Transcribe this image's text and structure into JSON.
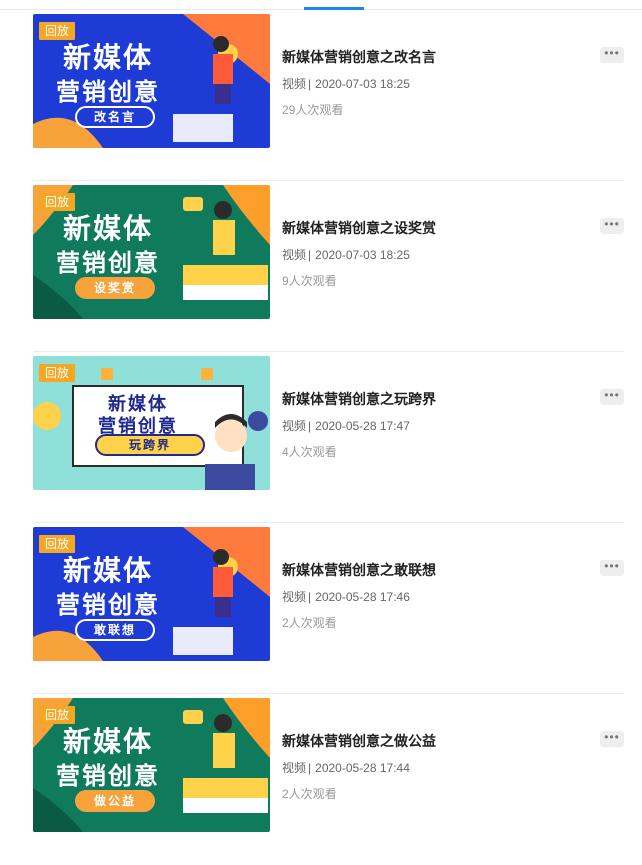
{
  "badge_label": "回放",
  "more_label": "•••",
  "items": [
    {
      "title": "新媒体营销创意之改名言",
      "type": "视频",
      "separator": "|",
      "date": "2020-07-03 18:25",
      "views": "29人次观看",
      "thumb": {
        "line1": "新媒体",
        "line2": "营销创意",
        "tag": "改名言",
        "theme": "blue"
      }
    },
    {
      "title": "新媒体营销创意之设奖赏",
      "type": "视频",
      "separator": "|",
      "date": "2020-07-03 18:25",
      "views": "9人次观看",
      "thumb": {
        "line1": "新媒体",
        "line2": "营销创意",
        "tag": "设奖赏",
        "theme": "green"
      }
    },
    {
      "title": "新媒体营销创意之玩跨界",
      "type": "视频",
      "separator": "|",
      "date": "2020-05-28 17:47",
      "views": "4人次观看",
      "thumb": {
        "line1": "新媒体",
        "line2": "营销创意",
        "tag": "玩跨界",
        "theme": "teal"
      }
    },
    {
      "title": "新媒体营销创意之敢联想",
      "type": "视频",
      "separator": "|",
      "date": "2020-05-28 17:46",
      "views": "2人次观看",
      "thumb": {
        "line1": "新媒体",
        "line2": "营销创意",
        "tag": "敢联想",
        "theme": "blue"
      }
    },
    {
      "title": "新媒体营销创意之做公益",
      "type": "视频",
      "separator": "|",
      "date": "2020-05-28 17:44",
      "views": "2人次观看",
      "thumb": {
        "line1": "新媒体",
        "line2": "营销创意",
        "tag": "做公益",
        "theme": "green"
      }
    }
  ],
  "colors": {
    "accent": "#1e88e5",
    "badge": "#f5a623",
    "blue_theme": "#1f3bd6",
    "green_theme": "#0f7a5c",
    "teal_theme": "#8fe0d8"
  }
}
